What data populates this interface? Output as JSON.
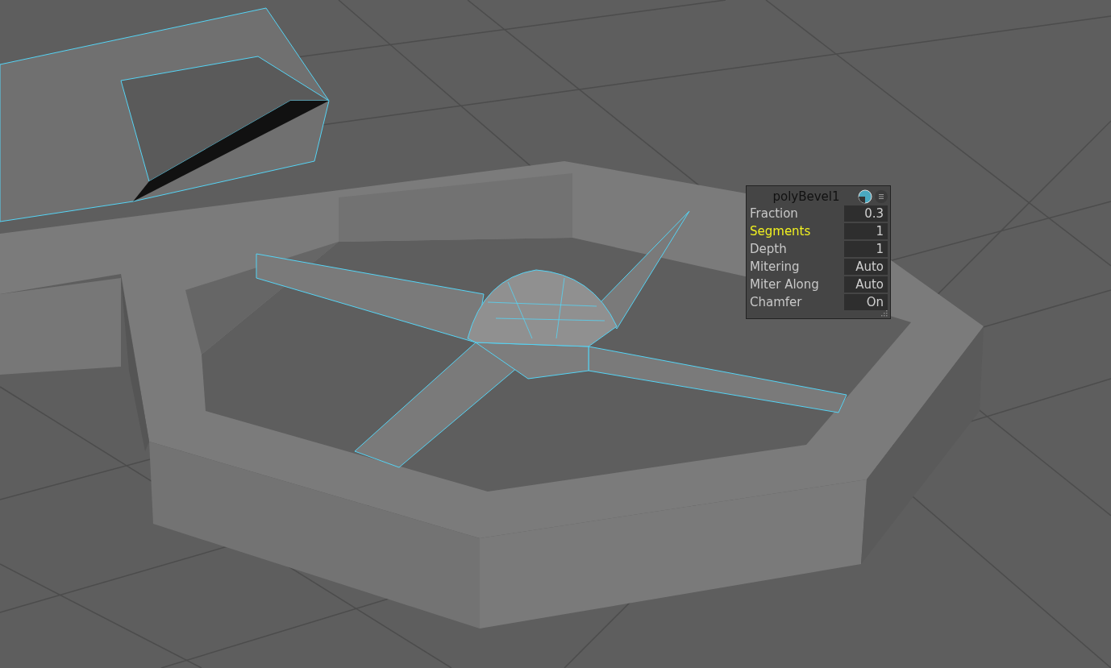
{
  "panel": {
    "title": "polyBevel1",
    "attributes": [
      {
        "label": "Fraction",
        "value": "0.3",
        "selected": false
      },
      {
        "label": "Segments",
        "value": "1",
        "selected": true
      },
      {
        "label": "Depth",
        "value": "1",
        "selected": false
      },
      {
        "label": "Mitering",
        "value": "Auto",
        "selected": false
      },
      {
        "label": "Miter Along",
        "value": "Auto",
        "selected": false
      },
      {
        "label": "Chamfer",
        "value": "On",
        "selected": false
      }
    ]
  }
}
